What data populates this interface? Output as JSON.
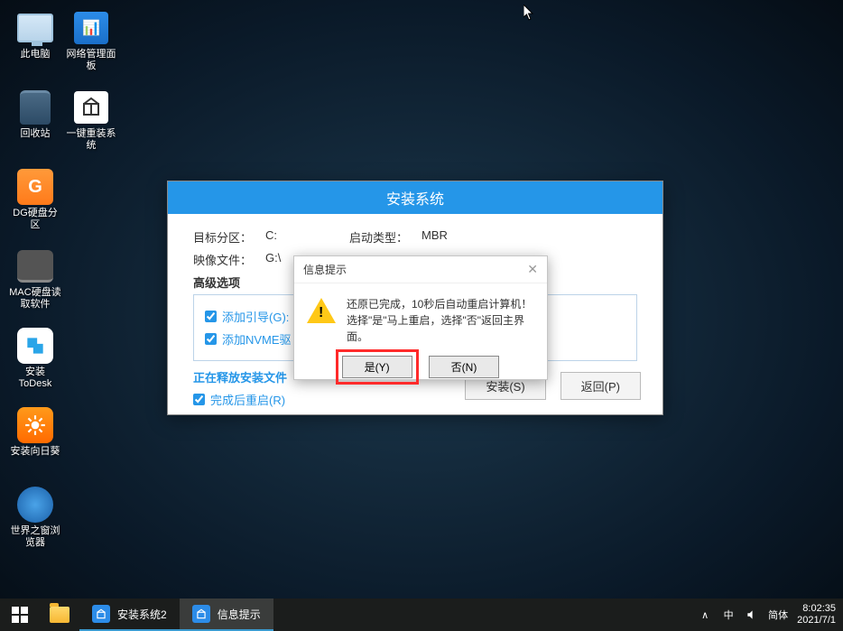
{
  "desktop": {
    "icons": [
      {
        "name": "this-pc",
        "label": "此电脑"
      },
      {
        "name": "net-panel",
        "label": "网络管理面板"
      },
      {
        "name": "recycle-bin",
        "label": "回收站"
      },
      {
        "name": "one-click-reinstall",
        "label": "一键重装系统"
      },
      {
        "name": "dg-partition",
        "label": "DG硬盘分区"
      },
      {
        "name": "empty1",
        "label": ""
      },
      {
        "name": "mac-disk-reader",
        "label": "MAC硬盘读取软件"
      },
      {
        "name": "empty2",
        "label": ""
      },
      {
        "name": "install-todesk",
        "label": "安装ToDesk"
      },
      {
        "name": "empty3",
        "label": ""
      },
      {
        "name": "install-sunflower",
        "label": "安装向日葵"
      },
      {
        "name": "empty4",
        "label": ""
      },
      {
        "name": "world-browser",
        "label": "世界之窗浏览器"
      }
    ]
  },
  "installer": {
    "title": "安装系统",
    "target_label": "目标分区：",
    "target_value": "C:",
    "boot_label": "启动类型：",
    "boot_value": "MBR",
    "image_label": "映像文件：",
    "image_value": "G:\\",
    "advanced_label": "高级选项",
    "opt_add_boot": "添加引导(G):",
    "opt_add_nvme": "添加NVME驱",
    "progress_label": "正在释放安装文件",
    "opt_restart": "完成后重启(R)",
    "btn_install": "安装(S)",
    "btn_back": "返回(P)"
  },
  "modal": {
    "title": "信息提示",
    "line1": "还原已完成，10秒后自动重启计算机！",
    "line2": "选择\"是\"马上重启，选择\"否\"返回主界面。",
    "btn_yes": "是(Y)",
    "btn_no": "否(N)"
  },
  "taskbar": {
    "apps": [
      {
        "label": "安装系统2",
        "active": false
      },
      {
        "label": "信息提示",
        "active": true
      }
    ],
    "ime": "简体",
    "ime_icon": "中",
    "time": "8:02:35",
    "date": "2021/7/1"
  }
}
